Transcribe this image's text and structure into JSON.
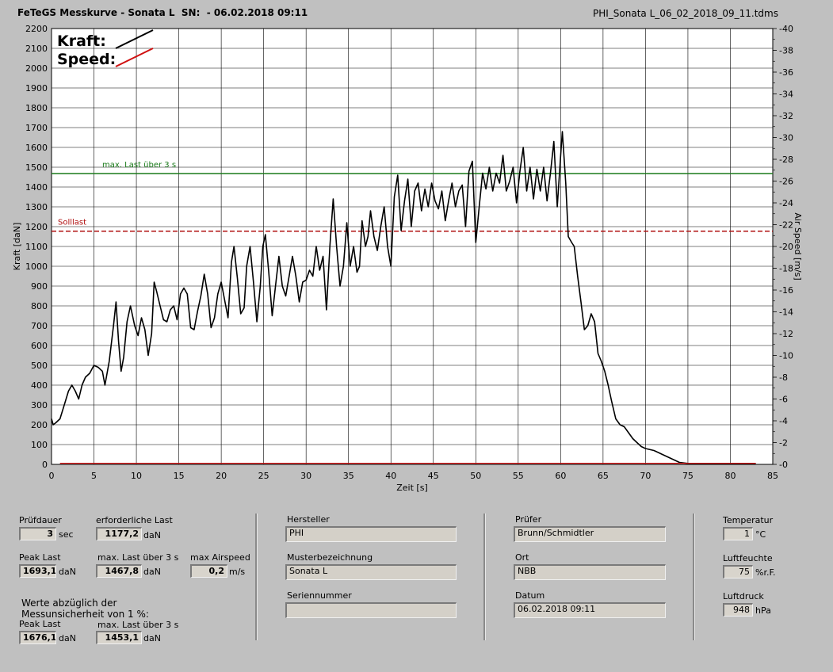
{
  "header": {
    "title": "FeTeGS Messkurve - Sonata L  SN:  - 06.02.2018 09:11",
    "filename": "PHI_Sonata L_06_02_2018_09_11.tdms"
  },
  "chart_data": {
    "type": "line",
    "xlabel": "Zeit [s]",
    "ylabel": "Kraft [daN]",
    "y2label": "Air Speed [m/s]",
    "xlim": [
      0,
      85
    ],
    "ylim": [
      0,
      2200
    ],
    "y2lim": [
      0,
      40
    ],
    "xticks": [
      "0",
      "5",
      "10",
      "15",
      "20",
      "25",
      "30",
      "35",
      "40",
      "45",
      "50",
      "55",
      "60",
      "65",
      "70",
      "75",
      "80",
      "85"
    ],
    "yticks": [
      "0",
      "100",
      "200",
      "300",
      "400",
      "500",
      "600",
      "700",
      "800",
      "900",
      "1000",
      "1100",
      "1200",
      "1300",
      "1400",
      "1500",
      "1600",
      "1700",
      "1800",
      "1900",
      "2000",
      "2100",
      "2200"
    ],
    "y2ticks": [
      "0",
      "2",
      "4",
      "6",
      "8",
      "10",
      "12",
      "14",
      "16",
      "18",
      "20",
      "22",
      "24",
      "26",
      "28",
      "30",
      "32",
      "34",
      "36",
      "38",
      "40"
    ],
    "legend": [
      {
        "name": "Kraft:",
        "color": "#000000"
      },
      {
        "name": "Speed:",
        "color": "#d01010"
      }
    ],
    "reference_lines": [
      {
        "label": "max. Last über  3 s",
        "value": 1467.8,
        "color": "#1a7a1a",
        "style": "solid"
      },
      {
        "label": "Solllast",
        "value": 1177.2,
        "color": "#b01010",
        "style": "dashed"
      }
    ],
    "series": [
      {
        "name": "Kraft:",
        "color": "#000000",
        "points": [
          [
            0,
            230
          ],
          [
            0.2,
            200
          ],
          [
            0.5,
            210
          ],
          [
            1,
            230
          ],
          [
            1.5,
            300
          ],
          [
            2,
            370
          ],
          [
            2.4,
            400
          ],
          [
            2.8,
            370
          ],
          [
            3.2,
            330
          ],
          [
            3.6,
            400
          ],
          [
            4,
            440
          ],
          [
            4.5,
            460
          ],
          [
            5,
            500
          ],
          [
            5.5,
            490
          ],
          [
            6,
            470
          ],
          [
            6.3,
            400
          ],
          [
            6.8,
            520
          ],
          [
            7.3,
            700
          ],
          [
            7.6,
            820
          ],
          [
            7.9,
            620
          ],
          [
            8.2,
            470
          ],
          [
            8.5,
            540
          ],
          [
            8.9,
            720
          ],
          [
            9.3,
            800
          ],
          [
            9.8,
            700
          ],
          [
            10.2,
            650
          ],
          [
            10.6,
            740
          ],
          [
            11,
            680
          ],
          [
            11.4,
            550
          ],
          [
            11.8,
            660
          ],
          [
            12.1,
            920
          ],
          [
            12.4,
            870
          ],
          [
            12.8,
            800
          ],
          [
            13.2,
            730
          ],
          [
            13.6,
            720
          ],
          [
            14,
            780
          ],
          [
            14.4,
            800
          ],
          [
            14.8,
            730
          ],
          [
            15.2,
            860
          ],
          [
            15.6,
            890
          ],
          [
            16,
            860
          ],
          [
            16.4,
            690
          ],
          [
            16.8,
            680
          ],
          [
            17.2,
            770
          ],
          [
            17.6,
            850
          ],
          [
            18,
            960
          ],
          [
            18.4,
            860
          ],
          [
            18.8,
            690
          ],
          [
            19.2,
            740
          ],
          [
            19.6,
            860
          ],
          [
            20,
            920
          ],
          [
            20.4,
            830
          ],
          [
            20.8,
            740
          ],
          [
            21.2,
            1020
          ],
          [
            21.5,
            1100
          ],
          [
            21.9,
            940
          ],
          [
            22.3,
            760
          ],
          [
            22.7,
            790
          ],
          [
            23,
            1000
          ],
          [
            23.4,
            1100
          ],
          [
            23.8,
            920
          ],
          [
            24.2,
            720
          ],
          [
            24.6,
            900
          ],
          [
            24.9,
            1100
          ],
          [
            25.2,
            1160
          ],
          [
            25.6,
            970
          ],
          [
            26,
            750
          ],
          [
            26.4,
            900
          ],
          [
            26.8,
            1050
          ],
          [
            27.2,
            900
          ],
          [
            27.6,
            850
          ],
          [
            28,
            950
          ],
          [
            28.4,
            1050
          ],
          [
            28.8,
            950
          ],
          [
            29.2,
            820
          ],
          [
            29.6,
            920
          ],
          [
            30,
            930
          ],
          [
            30.4,
            980
          ],
          [
            30.8,
            950
          ],
          [
            31.2,
            1100
          ],
          [
            31.6,
            980
          ],
          [
            32,
            1050
          ],
          [
            32.4,
            780
          ],
          [
            32.8,
            1100
          ],
          [
            33.2,
            1340
          ],
          [
            33.6,
            1100
          ],
          [
            34,
            900
          ],
          [
            34.4,
            1000
          ],
          [
            34.8,
            1220
          ],
          [
            35.2,
            1000
          ],
          [
            35.6,
            1100
          ],
          [
            36,
            970
          ],
          [
            36.3,
            1000
          ],
          [
            36.6,
            1230
          ],
          [
            37,
            1100
          ],
          [
            37.3,
            1150
          ],
          [
            37.6,
            1280
          ],
          [
            38,
            1150
          ],
          [
            38.4,
            1080
          ],
          [
            38.8,
            1200
          ],
          [
            39.2,
            1300
          ],
          [
            39.6,
            1100
          ],
          [
            40,
            1000
          ],
          [
            40.4,
            1350
          ],
          [
            40.8,
            1460
          ],
          [
            41.2,
            1180
          ],
          [
            41.6,
            1330
          ],
          [
            42,
            1440
          ],
          [
            42.4,
            1200
          ],
          [
            42.8,
            1380
          ],
          [
            43.2,
            1420
          ],
          [
            43.6,
            1280
          ],
          [
            44,
            1390
          ],
          [
            44.4,
            1300
          ],
          [
            44.8,
            1420
          ],
          [
            45.2,
            1330
          ],
          [
            45.6,
            1290
          ],
          [
            46,
            1380
          ],
          [
            46.4,
            1230
          ],
          [
            46.8,
            1330
          ],
          [
            47.2,
            1420
          ],
          [
            47.6,
            1300
          ],
          [
            48,
            1380
          ],
          [
            48.4,
            1410
          ],
          [
            48.8,
            1200
          ],
          [
            49.2,
            1480
          ],
          [
            49.6,
            1530
          ],
          [
            50,
            1120
          ],
          [
            50.4,
            1300
          ],
          [
            50.8,
            1470
          ],
          [
            51.2,
            1390
          ],
          [
            51.6,
            1500
          ],
          [
            52,
            1380
          ],
          [
            52.4,
            1470
          ],
          [
            52.8,
            1420
          ],
          [
            53.2,
            1560
          ],
          [
            53.6,
            1380
          ],
          [
            54,
            1430
          ],
          [
            54.4,
            1500
          ],
          [
            54.8,
            1320
          ],
          [
            55.2,
            1480
          ],
          [
            55.6,
            1600
          ],
          [
            56,
            1380
          ],
          [
            56.4,
            1500
          ],
          [
            56.8,
            1340
          ],
          [
            57.2,
            1490
          ],
          [
            57.6,
            1380
          ],
          [
            58,
            1500
          ],
          [
            58.4,
            1330
          ],
          [
            58.8,
            1470
          ],
          [
            59.2,
            1630
          ],
          [
            59.6,
            1300
          ],
          [
            60,
            1560
          ],
          [
            60.2,
            1680
          ],
          [
            60.6,
            1420
          ],
          [
            60.9,
            1150
          ],
          [
            61.3,
            1120
          ],
          [
            61.6,
            1100
          ],
          [
            62,
            950
          ],
          [
            62.4,
            820
          ],
          [
            62.8,
            680
          ],
          [
            63.2,
            700
          ],
          [
            63.6,
            760
          ],
          [
            64,
            720
          ],
          [
            64.4,
            560
          ],
          [
            64.8,
            520
          ],
          [
            65.2,
            470
          ],
          [
            65.6,
            400
          ],
          [
            66,
            320
          ],
          [
            66.5,
            230
          ],
          [
            67,
            200
          ],
          [
            67.5,
            190
          ],
          [
            68,
            160
          ],
          [
            68.5,
            130
          ],
          [
            69,
            110
          ],
          [
            69.5,
            90
          ],
          [
            70,
            80
          ],
          [
            71,
            70
          ],
          [
            71.5,
            60
          ],
          [
            72,
            50
          ],
          [
            73,
            30
          ],
          [
            73.5,
            20
          ],
          [
            74,
            10
          ],
          [
            75,
            5
          ],
          [
            78,
            5
          ],
          [
            80,
            3
          ],
          [
            83,
            3
          ]
        ]
      },
      {
        "name": "Speed:",
        "color": "#d01010",
        "points": [
          [
            1,
            0.1
          ],
          [
            83,
            0.1
          ]
        ]
      }
    ]
  },
  "left_panel": {
    "pruefdauer_label": "Prüfdauer",
    "pruefdauer_value": "3",
    "pruefdauer_unit": "sec",
    "erf_last_label": "erforderliche Last",
    "erf_last_value": "1177,2",
    "erf_last_unit": "daN",
    "peak_last_label": "Peak Last",
    "peak_last_value": "1693,1",
    "peak_last_unit": "daN",
    "max_last_label": "max. Last über  3 s",
    "max_last_value": "1467,8",
    "max_last_unit": "daN",
    "airspeed_label": "max Airspeed",
    "airspeed_value": "0,2",
    "airspeed_unit": "m/s",
    "werte_line1": "Werte abzüglich der",
    "werte_line2": "Messunsicherheit von 1  %:",
    "peak_last2_label": "Peak Last",
    "peak_last2_value": "1676,1",
    "peak_last2_unit": "daN",
    "max_last2_label": "max. Last über  3 s",
    "max_last2_value": "1453,1",
    "max_last2_unit": "daN"
  },
  "middle_panel": {
    "hersteller_label": "Hersteller",
    "hersteller_value": "PHI",
    "muster_label": "Musterbezeichnung",
    "muster_value": "Sonata L",
    "serien_label": "Seriennummer",
    "serien_value": ""
  },
  "right_panel": {
    "pruefer_label": "Prüfer",
    "pruefer_value": "Brunn/Schmidtler",
    "ort_label": "Ort",
    "ort_value": "NBB",
    "datum_label": "Datum",
    "datum_value": "06.02.2018 09:11"
  },
  "env_panel": {
    "temp_label": "Temperatur",
    "temp_value": "1",
    "temp_unit": "°C",
    "feuchte_label": "Luftfeuchte",
    "feuchte_value": "75",
    "feuchte_unit": "%r.F.",
    "druck_label": "Luftdruck",
    "druck_value": "948",
    "druck_unit": "hPa"
  }
}
